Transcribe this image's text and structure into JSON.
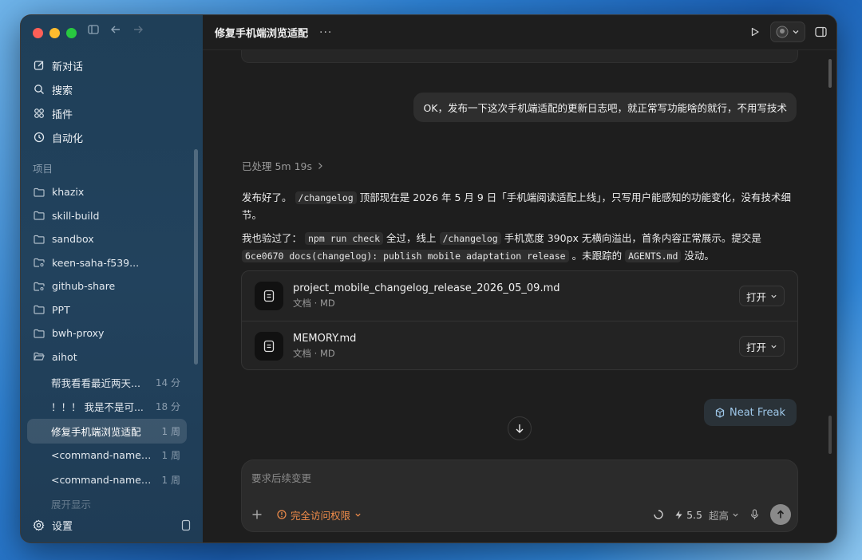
{
  "sidebar": {
    "nav": [
      {
        "label": "新对话",
        "icon": "compose-icon"
      },
      {
        "label": "搜索",
        "icon": "search-icon"
      },
      {
        "label": "插件",
        "icon": "plugins-icon"
      },
      {
        "label": "自动化",
        "icon": "clock-icon"
      }
    ],
    "section_label": "项目",
    "projects": [
      {
        "label": "khazix",
        "icon": "folder-icon"
      },
      {
        "label": "skill-build",
        "icon": "folder-icon"
      },
      {
        "label": "sandbox",
        "icon": "folder-icon"
      },
      {
        "label": "keen-saha-f539...",
        "icon": "branch-folder-icon"
      },
      {
        "label": "github-share",
        "icon": "branch-folder-icon"
      },
      {
        "label": "PPT",
        "icon": "folder-icon"
      },
      {
        "label": "bwh-proxy",
        "icon": "folder-icon"
      },
      {
        "label": "aihot",
        "icon": "folder-open-icon"
      }
    ],
    "chats": [
      {
        "title": "帮我看看最近两天...",
        "time": "14 分"
      },
      {
        "title": "！！！ 我是不是可...",
        "time": "18 分"
      },
      {
        "title": "修复手机端浏览适配",
        "time": "1 周"
      },
      {
        "title": "<command-name>/...",
        "time": "1 周"
      },
      {
        "title": "<command-name>/...",
        "time": "1 周"
      },
      {
        "title": "展开显示",
        "time": ""
      }
    ],
    "settings_label": "设置"
  },
  "header": {
    "title": "修复手机端浏览适配",
    "more": "···"
  },
  "conversation": {
    "user_message": "OK，发布一下这次手机端适配的更新日志吧，就正常写功能啥的就行，不用写技术",
    "processed": "已处理 5m 19s",
    "answer_p1": {
      "a": "发布好了。",
      "code1": "/changelog",
      "b": "顶部现在是 2026 年 5 月 9 日「手机端阅读适配上线」，只写用户能感知的功能变化，没有技术细节。"
    },
    "answer_p2": {
      "a": "我也验过了：",
      "code1": "npm run check",
      "b": "全过，线上",
      "code2": "/changelog",
      "c": "手机宽度 390px 无横向溢出，首条内容正常展示。提交是",
      "code3": "6ce0670 docs(changelog): publish mobile adaptation release",
      "d": "。未跟踪的",
      "code4": "AGENTS.md",
      "e": "没动。"
    },
    "files": [
      {
        "name": "project_mobile_changelog_release_2026_05_09.md",
        "meta": "文档 · MD",
        "open": "打开"
      },
      {
        "name": "MEMORY.md",
        "meta": "文档 · MD",
        "open": "打开"
      }
    ],
    "neat_freak": "Neat Freak"
  },
  "composer": {
    "placeholder": "要求后续变更",
    "permission": "完全访问权限",
    "model_version": "5.5",
    "quality": "超高"
  },
  "colors": {
    "accent_orange": "#f08c4a",
    "neat_blue": "#9ec7e8"
  }
}
